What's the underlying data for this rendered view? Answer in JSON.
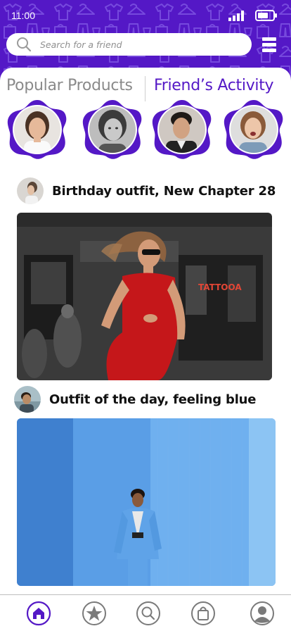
{
  "status_bar": {
    "time": "11:00"
  },
  "search": {
    "placeholder": "Search for a friend",
    "value": ""
  },
  "tabs": [
    {
      "label": "Popular Products",
      "active": false
    },
    {
      "label": "Friend’s Activity",
      "active": true
    }
  ],
  "stories": [
    "friend-story-1",
    "friend-story-2",
    "friend-story-3",
    "friend-story-4"
  ],
  "posts": [
    {
      "title": "Birthday outfit, New Chapter 28",
      "image_sign_text": "TATTOOA"
    },
    {
      "title": "Outfit of the day, feeling blue"
    }
  ],
  "bottom_nav": {
    "items": [
      "home-icon",
      "star-icon",
      "search-icon",
      "shopping-bag-icon",
      "profile-icon"
    ],
    "active": "home-icon"
  },
  "colors": {
    "brand": "#5418c6",
    "story_ring": "#5418c6",
    "inactive_icon": "#7a7a7a"
  }
}
